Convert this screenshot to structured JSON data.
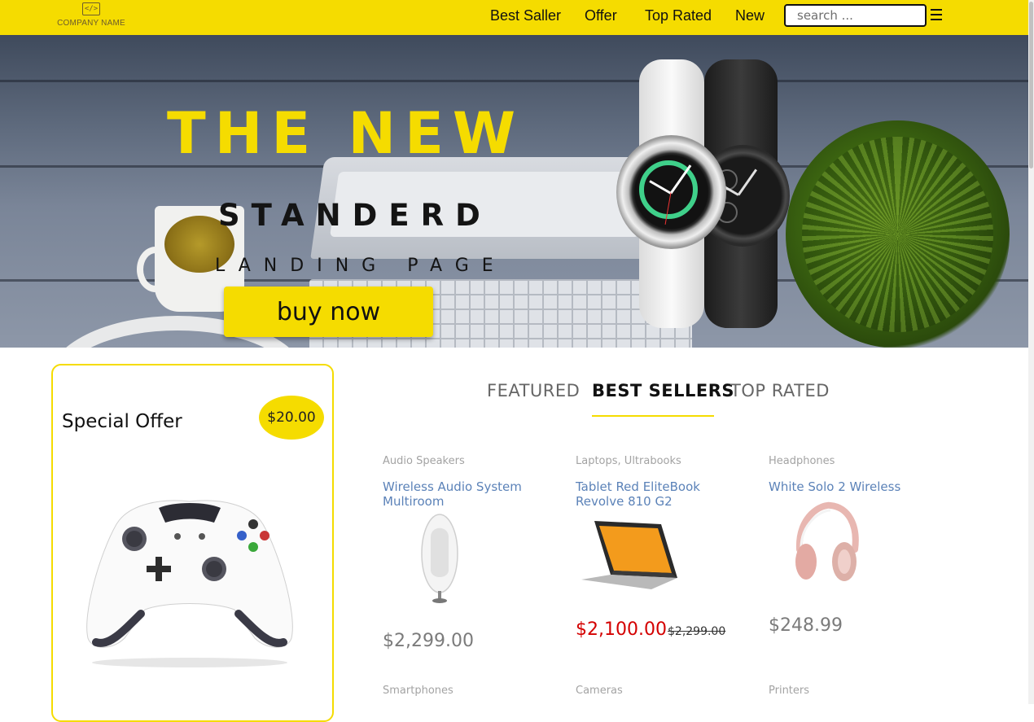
{
  "header": {
    "company_name": "COMPANY NAME",
    "logo_mark": "</>",
    "nav": [
      "Best Saller",
      "Offer",
      "Top Rated",
      "New"
    ],
    "search_placeholder": "search ...",
    "accent_color": "#f5dc00"
  },
  "hero": {
    "title": "THE NEW",
    "subtitle": "STANDERD",
    "tagline": "LANDING PAGE",
    "cta": "buy now"
  },
  "special_offer": {
    "title": "Special Offer",
    "price": "$20.00",
    "image_icon": "game-controller"
  },
  "tabs": {
    "items": [
      "FEATURED",
      "BEST SELLERS",
      "TOP RATED"
    ],
    "active": "BEST SELLERS"
  },
  "products": [
    {
      "category": "Audio Speakers",
      "name": "Wireless Audio System Multiroom",
      "price": "$2,299.00",
      "old_price": "",
      "image_icon": "speaker"
    },
    {
      "category": "Laptops, Ultrabooks",
      "name": "Tablet Red EliteBook Revolve 810 G2",
      "price": "$2,100.00",
      "old_price": "$2,299.00",
      "image_icon": "laptop"
    },
    {
      "category": "Headphones",
      "name": "White Solo 2 Wireless",
      "price": "$248.99",
      "old_price": "",
      "image_icon": "headphones"
    }
  ],
  "more_categories": [
    "Smartphones",
    "Cameras",
    "Printers"
  ]
}
